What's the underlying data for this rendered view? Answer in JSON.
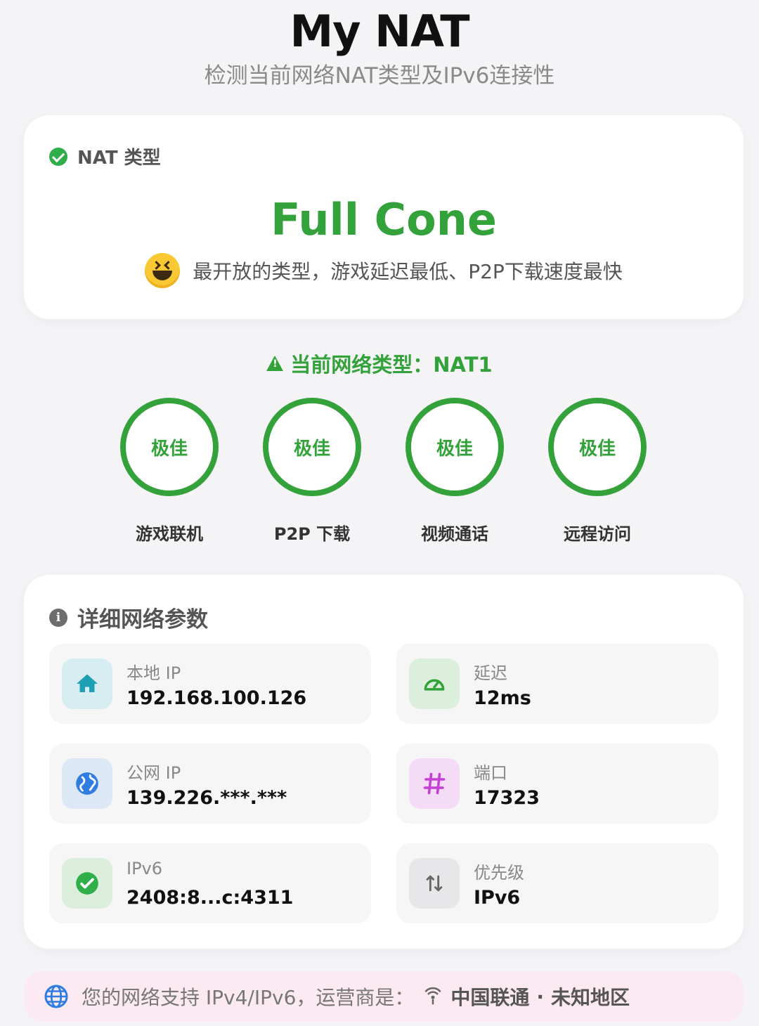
{
  "header": {
    "title": "My NAT",
    "subtitle": "检测当前网络NAT类型及IPv6连接性"
  },
  "nat_card": {
    "label": "NAT 类型",
    "type": "Full Cone",
    "description": "最开放的类型，游戏延迟最低、P2P下载速度最快"
  },
  "current_network": {
    "text": "当前网络类型：NAT1"
  },
  "usage": [
    {
      "rating": "极佳",
      "label": "游戏联机"
    },
    {
      "rating": "极佳",
      "label": "P2P 下载"
    },
    {
      "rating": "极佳",
      "label": "视频通话"
    },
    {
      "rating": "极佳",
      "label": "远程访问"
    }
  ],
  "details": {
    "title": "详细网络参数",
    "local_ip": {
      "label": "本地 IP",
      "value": "192.168.100.126",
      "icon": "home-icon"
    },
    "latency": {
      "label": "延迟",
      "value": "12ms",
      "icon": "speedometer-icon"
    },
    "public_ip": {
      "label": "公网 IP",
      "value": "139.226.***.***",
      "icon": "globe-icon"
    },
    "port": {
      "label": "端口",
      "value": "17323",
      "icon": "hash-icon"
    },
    "ipv6": {
      "label": "IPv6",
      "value": "2408:8...c:4311",
      "icon": "check-circle-icon"
    },
    "priority": {
      "label": "优先级",
      "value": "IPv6",
      "icon": "arrows-updown-icon"
    }
  },
  "footer": {
    "text": "您的网络支持 IPv4/IPv6，运营商是：",
    "isp": "中国联通",
    "separator": "·",
    "region": "未知地区"
  },
  "colors": {
    "accent_green": "#34a23a",
    "background": "#f4f4f6",
    "footer_bg": "#fbeaf1"
  }
}
